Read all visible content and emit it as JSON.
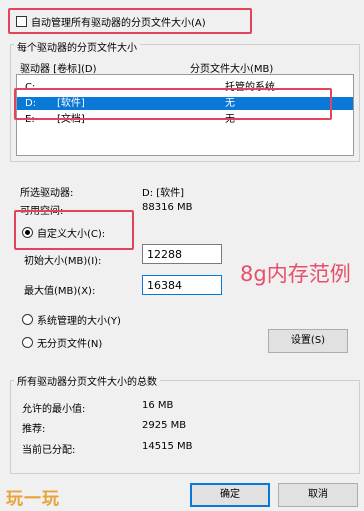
{
  "auto_manage": {
    "label": "自动管理所有驱动器的分页文件大小(A)",
    "checked": false
  },
  "per_drive": {
    "group_label": "每个驱动器的分页文件大小",
    "col_drive": "驱动器 [卷标](D)",
    "col_size": "分页文件大小(MB)",
    "rows": [
      {
        "drive": "C:",
        "label": "",
        "size": "托管的系统",
        "selected": false
      },
      {
        "drive": "D:",
        "label": "[软件]",
        "size": "无",
        "selected": true
      },
      {
        "drive": "E:",
        "label": "[文档]",
        "size": "无",
        "selected": false
      }
    ]
  },
  "selected_drive": {
    "drive_label": "所选驱动器:",
    "drive_value": "D:  [软件]",
    "free_label": "可用空间:",
    "free_value": "88316 MB"
  },
  "custom_size": {
    "label": "自定义大小(C):",
    "selected": true
  },
  "initial_size": {
    "label": "初始大小(MB)(I):",
    "value": "12288"
  },
  "max_size": {
    "label": "最大值(MB)(X):",
    "value": "16384"
  },
  "annotation": "8g内存范例",
  "system_managed": {
    "label": "系统管理的大小(Y)",
    "selected": false
  },
  "no_paging": {
    "label": "无分页文件(N)",
    "selected": false
  },
  "set_button": "设置(S)",
  "totals": {
    "group_label": "所有驱动器分页文件大小的总数",
    "min_label": "允许的最小值:",
    "min_value": "16 MB",
    "rec_label": "推荐:",
    "rec_value": "2925 MB",
    "cur_label": "当前已分配:",
    "cur_value": "14515 MB"
  },
  "ok_button": "确定",
  "cancel_button": "取消",
  "watermark": "玩一玩",
  "colors": {
    "highlight_box": "#e0465a",
    "selection": "#0a78d7",
    "annotation": "#e6506a"
  }
}
